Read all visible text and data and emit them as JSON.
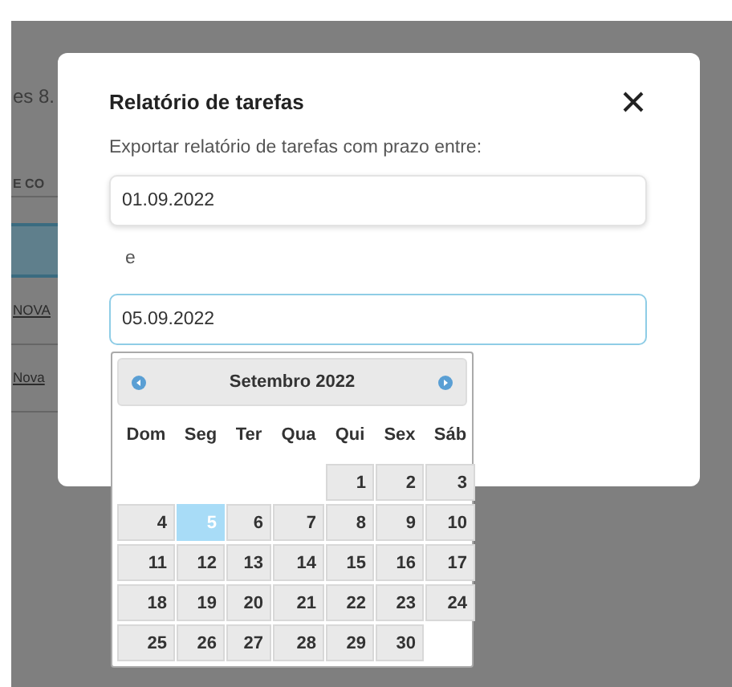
{
  "background_page": {
    "heading": "es 8.",
    "column_header": "E CO",
    "rows": [
      {
        "link": "NOVA",
        "selected": false
      },
      {
        "link": "Nova",
        "selected": false
      }
    ]
  },
  "dialog": {
    "title": "Relatório de tarefas",
    "description": "Exportar relatório de tarefas com prazo entre:",
    "start_date": {
      "value": "01.09.2022",
      "focused": false
    },
    "separator": "e",
    "end_date": {
      "value": "05.09.2022",
      "focused": true
    },
    "datepicker": {
      "month": "Setembro 2022",
      "weekdays": [
        "Dom",
        "Seg",
        "Ter",
        "Qua",
        "Qui",
        "Sex",
        "Sáb"
      ],
      "weeks": [
        [
          {
            "kind": "blank"
          },
          {
            "kind": "blank"
          },
          {
            "kind": "blank"
          },
          {
            "kind": "blank"
          },
          {
            "kind": "day",
            "day": "1",
            "selected": false
          },
          {
            "kind": "day",
            "day": "2",
            "selected": false
          },
          {
            "kind": "day",
            "day": "3",
            "selected": false
          }
        ],
        [
          {
            "kind": "day",
            "day": "4",
            "selected": false
          },
          {
            "kind": "day",
            "day": "5",
            "selected": true
          },
          {
            "kind": "day",
            "day": "6",
            "selected": false
          },
          {
            "kind": "day",
            "day": "7",
            "selected": false
          },
          {
            "kind": "day",
            "day": "8",
            "selected": false
          },
          {
            "kind": "day",
            "day": "9",
            "selected": false
          },
          {
            "kind": "day",
            "day": "10",
            "selected": false
          }
        ],
        [
          {
            "kind": "day",
            "day": "11",
            "selected": false
          },
          {
            "kind": "day",
            "day": "12",
            "selected": false
          },
          {
            "kind": "day",
            "day": "13",
            "selected": false
          },
          {
            "kind": "day",
            "day": "14",
            "selected": false
          },
          {
            "kind": "day",
            "day": "15",
            "selected": false
          },
          {
            "kind": "day",
            "day": "16",
            "selected": false
          },
          {
            "kind": "day",
            "day": "17",
            "selected": false
          }
        ],
        [
          {
            "kind": "day",
            "day": "18",
            "selected": false
          },
          {
            "kind": "day",
            "day": "19",
            "selected": false
          },
          {
            "kind": "day",
            "day": "20",
            "selected": false
          },
          {
            "kind": "day",
            "day": "21",
            "selected": false
          },
          {
            "kind": "day",
            "day": "22",
            "selected": false
          },
          {
            "kind": "day",
            "day": "23",
            "selected": false
          },
          {
            "kind": "day",
            "day": "24",
            "selected": false
          }
        ],
        [
          {
            "kind": "day",
            "day": "25",
            "selected": false
          },
          {
            "kind": "day",
            "day": "26",
            "selected": false
          },
          {
            "kind": "day",
            "day": "27",
            "selected": false
          },
          {
            "kind": "day",
            "day": "28",
            "selected": false
          },
          {
            "kind": "day",
            "day": "29",
            "selected": false
          },
          {
            "kind": "day",
            "day": "30",
            "selected": false
          },
          {
            "kind": "blank"
          }
        ]
      ]
    }
  }
}
